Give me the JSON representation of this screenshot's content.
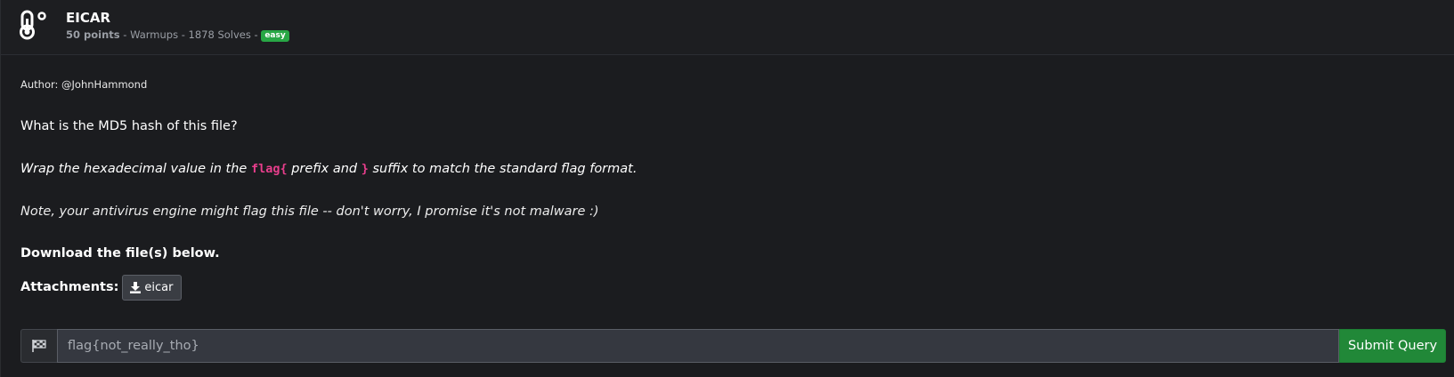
{
  "challenge": {
    "title": "EICAR",
    "points": "50 points",
    "meta_rest": " - Warmups - 1878 Solves - ",
    "difficulty": "easy",
    "icon": "thermometer-icon"
  },
  "description": {
    "author": "Author: @JohnHammond",
    "question": "What is the MD5 hash of this file?",
    "wrap_part1": "Wrap the hexadecimal value in the ",
    "wrap_code1": "flag{",
    "wrap_part2": " prefix and ",
    "wrap_code2": "}",
    "wrap_part3": " suffix to match the standard flag format.",
    "note": "Note, your antivirus engine might flag this file -- don't worry, I promise it's not malware :)",
    "download": "Download the file(s) below."
  },
  "attachments": {
    "label": "Attachments:",
    "items": [
      {
        "name": "eicar",
        "icon": "download-icon"
      }
    ]
  },
  "flag_form": {
    "icon": "checkered-flag-icon",
    "placeholder": "flag{not_really_tho}",
    "value": "",
    "submit_label": "Submit Query"
  },
  "colors": {
    "background": "#1b1c1f",
    "badge_easy": "#28a745",
    "code_highlight": "#e83e8c",
    "submit": "#218838"
  }
}
